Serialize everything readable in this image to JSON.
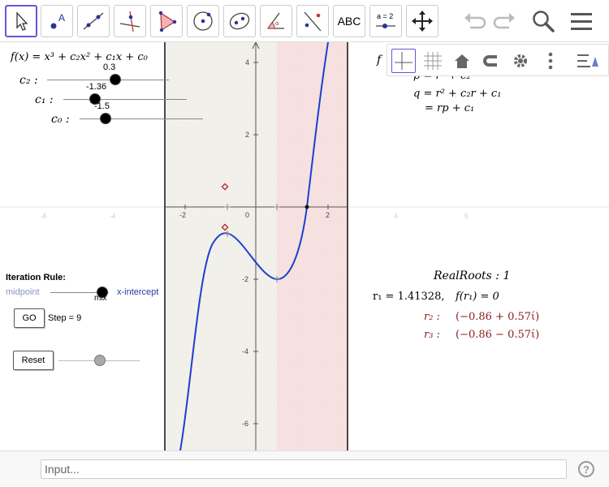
{
  "toolbar": {
    "tools": [
      {
        "name": "move-tool",
        "icon": "cursor-icon"
      },
      {
        "name": "point-tool",
        "icon": "point-icon"
      },
      {
        "name": "line-tool",
        "icon": "line-icon"
      },
      {
        "name": "perpendicular-tool",
        "icon": "perpendicular-icon"
      },
      {
        "name": "polygon-tool",
        "icon": "polygon-icon"
      },
      {
        "name": "circle-tool",
        "icon": "circle-icon"
      },
      {
        "name": "ellipse-tool",
        "icon": "ellipse-icon"
      },
      {
        "name": "angle-tool",
        "icon": "angle-icon"
      },
      {
        "name": "reflect-tool",
        "icon": "reflect-icon"
      },
      {
        "name": "text-tool",
        "label": "ABC"
      },
      {
        "name": "slider-tool",
        "label": "a = 2"
      },
      {
        "name": "move-graphics-tool",
        "icon": "move-arrows-icon"
      }
    ],
    "right": {
      "undo": "undo-icon",
      "redo": "redo-icon",
      "search": "search-icon",
      "menu": "menu-icon"
    }
  },
  "left_panel": {
    "function": "f(x) = x³ + c₂x² + c₁x + c₀",
    "sliders": [
      {
        "label": "c₂ :",
        "value": "0.3"
      },
      {
        "label": "c₁ :",
        "value": "-1.36"
      },
      {
        "label": "c₀ :",
        "value": "-1.5"
      }
    ],
    "iteration_rule": "Iteration Rule:",
    "rule_left": "midpoint",
    "rule_mid": "mix",
    "rule_right": "x-intercept",
    "go_label": "GO",
    "step_text": "Step = 9",
    "reset_label": "Reset"
  },
  "right_panel": {
    "f_partial": "f",
    "p_partial": "p = r² + c₂",
    "q_line": "q = r² + c₂r + c₁",
    "q_line2": "= rp + c₁",
    "real_roots": "RealRoots : 1",
    "r1": "r₁ = 1.41328,",
    "fr1": "f(r₁) = 0",
    "r2_label": "r₂ :",
    "r2_value": "(−0.86 + 0.57ί)",
    "r3_label": "r₃ :",
    "r3_value": "(−0.86 − 0.57ί)"
  },
  "axes": {
    "x_ticks": [
      "-6",
      "-4",
      "-2",
      "0",
      "2",
      "4",
      "6"
    ],
    "y_ticks": [
      "4",
      "2",
      "-2",
      "-4",
      "-6"
    ]
  },
  "input_bar": {
    "placeholder": "Input..."
  },
  "colors": {
    "curve": "#1a3fd0",
    "accent": "#6557d2",
    "root_text": "#8b1a1a",
    "shade": "#f9e6e6"
  }
}
